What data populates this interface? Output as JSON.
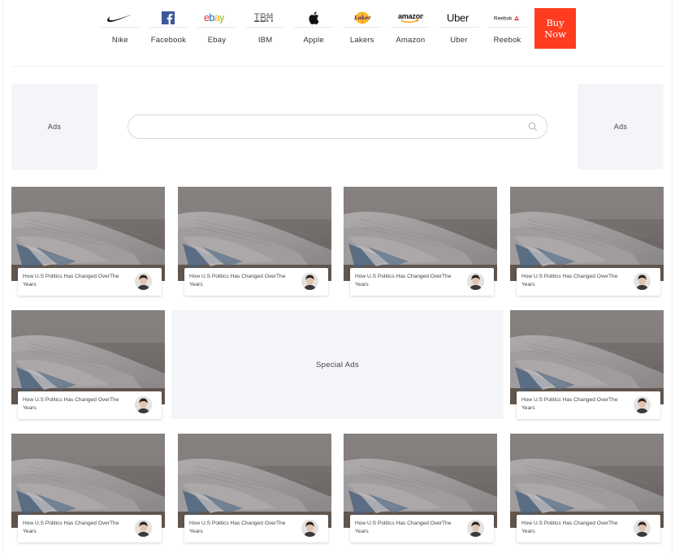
{
  "brands": [
    {
      "name": "Nike",
      "icon": "nike-swoosh-icon"
    },
    {
      "name": "Facebook",
      "icon": "facebook-icon"
    },
    {
      "name": "Ebay",
      "icon": "ebay-logo-icon"
    },
    {
      "name": "IBM",
      "icon": "ibm-logo-icon"
    },
    {
      "name": "Apple",
      "icon": "apple-icon"
    },
    {
      "name": "Lakers",
      "icon": "lakers-logo-icon"
    },
    {
      "name": "Amazon",
      "icon": "amazon-logo-icon"
    },
    {
      "name": "Uber",
      "icon": "uber-logo-icon"
    },
    {
      "name": "Reebok",
      "icon": "reebok-logo-icon"
    }
  ],
  "logo_text": {
    "ebay": "ebay",
    "ibm": "IBM",
    "amazon": "amazon",
    "uber": "Uber",
    "reebok": "Reebok",
    "lakers": "Lakers"
  },
  "buy_now_label": "Buy Now",
  "ads": {
    "left_label": "Ads",
    "right_label": "Ads",
    "special_label": "Special Ads"
  },
  "search": {
    "placeholder": "",
    "value": ""
  },
  "cards": [
    {
      "title": "How U.S Politics Has Changed OverThe Years"
    },
    {
      "title": "How U.S Politics Has Changed OverThe Years"
    },
    {
      "title": "How U.S Politics Has Changed OverThe Years"
    },
    {
      "title": "How U.S Politics Has Changed OverThe Years"
    },
    {
      "title": "How U.S Politics Has Changed OverThe Years"
    },
    {
      "title": "How U.S Politics Has Changed OverThe Years"
    },
    {
      "title": "How U.S Politics Has Changed OverThe Years"
    },
    {
      "title": "How U.S Politics Has Changed OverThe Years"
    },
    {
      "title": "How U.S Politics Has Changed OverThe Years"
    },
    {
      "title": "How U.S Politics Has Changed OverThe Years"
    }
  ],
  "colors": {
    "accent": "#ff3c1f",
    "ad_background": "#f4f5f8",
    "facebook": "#3b5998"
  }
}
